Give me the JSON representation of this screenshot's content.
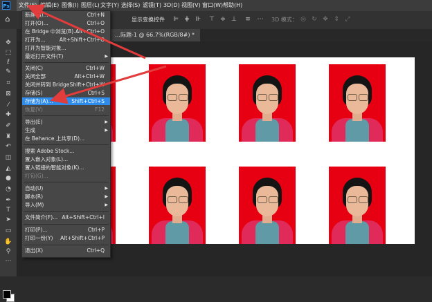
{
  "app": {
    "logo": "Ps"
  },
  "menubar": {
    "items": [
      "文件(F)",
      "编辑(E)",
      "图像(I)",
      "图层(L)",
      "文字(Y)",
      "选择(S)",
      "滤镜(T)",
      "3D(D)",
      "视图(V)",
      "窗口(W)",
      "帮助(H)"
    ]
  },
  "options": {
    "show_transform": "显示变换控件",
    "mode3d": "3D 模式："
  },
  "document": {
    "tab_title": "…际题-1 @ 66.7%(RGB/8#) *"
  },
  "file_menu": [
    {
      "label": "新建(N)...",
      "shortcut": "Ctrl+N"
    },
    {
      "label": "打开(O)...",
      "shortcut": "Ctrl+O"
    },
    {
      "label": "在 Bridge 中浏览(B)...",
      "shortcut": "Alt+Ctrl+O"
    },
    {
      "label": "打开为...",
      "shortcut": "Alt+Shift+Ctrl+O"
    },
    {
      "label": "打开为智能对象...",
      "shortcut": ""
    },
    {
      "label": "最近打开文件(T)",
      "shortcut": "",
      "submenu": true
    },
    {
      "label": "关闭(C)",
      "shortcut": "Ctrl+W"
    },
    {
      "label": "关闭全部",
      "shortcut": "Alt+Ctrl+W"
    },
    {
      "label": "关闭并转到 Bridge...",
      "shortcut": "Shift+Ctrl+W"
    },
    {
      "label": "存储(S)",
      "shortcut": "Ctrl+S"
    },
    {
      "label": "存储为(A)...",
      "shortcut": "Shift+Ctrl+S",
      "highlighted": true
    },
    {
      "label": "恢复(V)",
      "shortcut": "F12",
      "disabled": true
    },
    {
      "label": "导出(E)",
      "shortcut": "",
      "submenu": true
    },
    {
      "label": "生成",
      "shortcut": "",
      "submenu": true
    },
    {
      "label": "在 Behance 上共享(D)...",
      "shortcut": ""
    },
    {
      "label": "搜索 Adobe Stock...",
      "shortcut": ""
    },
    {
      "label": "置入嵌入对象(L)...",
      "shortcut": ""
    },
    {
      "label": "置入链接的智能对象(K)...",
      "shortcut": ""
    },
    {
      "label": "打包(G)...",
      "shortcut": "",
      "disabled": true
    },
    {
      "label": "自动(U)",
      "shortcut": "",
      "submenu": true
    },
    {
      "label": "脚本(R)",
      "shortcut": "",
      "submenu": true
    },
    {
      "label": "导入(M)",
      "shortcut": "",
      "submenu": true
    },
    {
      "label": "文件简介(F)...",
      "shortcut": "Alt+Shift+Ctrl+I"
    },
    {
      "label": "打印(P)...",
      "shortcut": "Ctrl+P"
    },
    {
      "label": "打印一份(Y)",
      "shortcut": "Alt+Shift+Ctrl+P"
    },
    {
      "label": "退出(X)",
      "shortcut": "Ctrl+Q"
    }
  ],
  "colors": {
    "highlight": "#2d8ceb",
    "photo_bg": "#e60012",
    "arrow": "#e23c3c"
  }
}
